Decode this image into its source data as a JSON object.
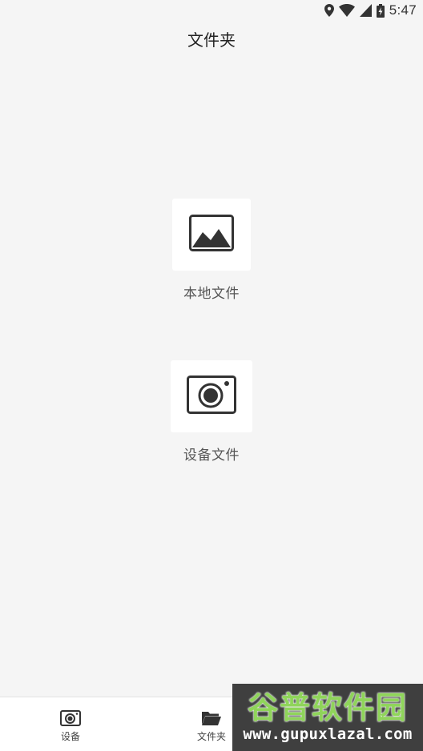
{
  "status_bar": {
    "time": "5:47",
    "icons": [
      "location-icon",
      "wifi-icon",
      "cell-signal-icon",
      "battery-charging-icon"
    ]
  },
  "header": {
    "title": "文件夹"
  },
  "folders": [
    {
      "label": "本地文件",
      "icon": "image-icon"
    },
    {
      "label": "设备文件",
      "icon": "camera-icon"
    }
  ],
  "bottom_nav": {
    "items": [
      {
        "label": "设备",
        "icon": "camera-icon"
      },
      {
        "label": "文件夹",
        "icon": "folder-icon"
      },
      {
        "label": "",
        "icon": "cloud-icon"
      }
    ]
  },
  "watermark": {
    "brand": "谷普软件园",
    "url": "www.gupuxlazal.com"
  },
  "colors": {
    "background": "#f5f5f5",
    "card": "#ffffff",
    "icon": "#333333",
    "watermark_bg": "#3f3f3f",
    "watermark_accent": "#8fd45a"
  }
}
